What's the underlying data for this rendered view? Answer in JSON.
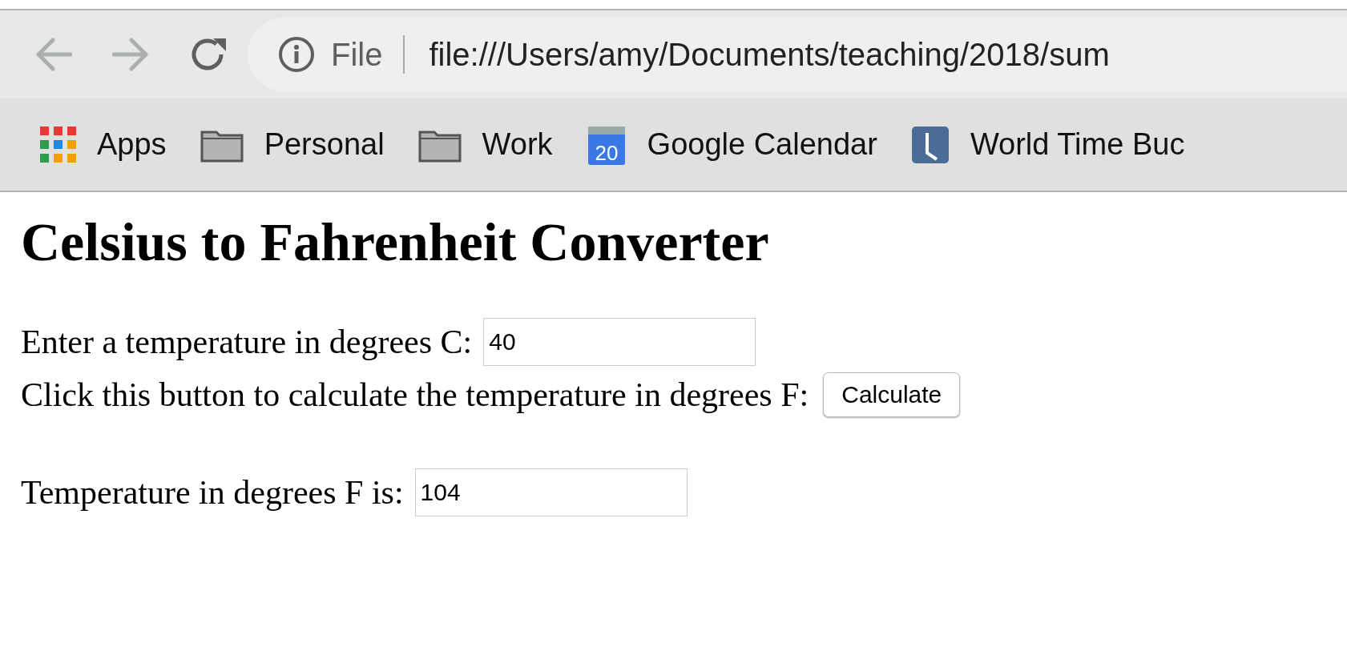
{
  "toolbar": {
    "info": "File",
    "url": "file:///Users/amy/Documents/teaching/2018/sum"
  },
  "bookmarks": [
    {
      "kind": "apps",
      "label": "Apps"
    },
    {
      "kind": "folder",
      "label": "Personal"
    },
    {
      "kind": "folder",
      "label": "Work"
    },
    {
      "kind": "calendar",
      "label": "Google Calendar",
      "icon_text": "20"
    },
    {
      "kind": "clock",
      "label": "World Time Buc"
    }
  ],
  "page": {
    "heading": "Celsius to Fahrenheit Converter",
    "celsius_label": "Enter a temperature in degrees C:",
    "celsius_value": "40",
    "button_prompt": "Click this button to calculate the temperature in degrees F:",
    "button": "Calculate",
    "result_label": "Temperature in degrees F is:",
    "result_value": "104"
  }
}
